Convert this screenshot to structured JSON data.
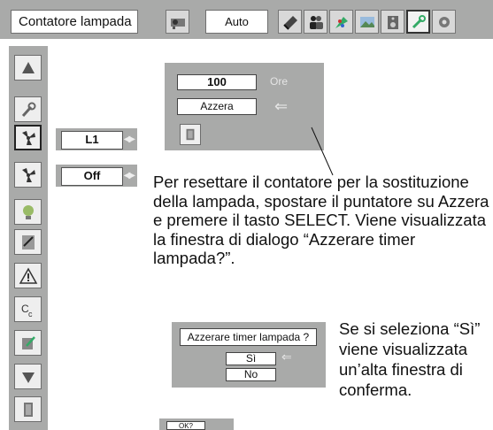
{
  "toolbar": {
    "title": "Contatore lampada",
    "mode_value": "Auto",
    "icons": [
      "projector-icon",
      "laptop-icon",
      "people-icon",
      "palette-icon",
      "image-icon",
      "speaker-icon",
      "wrench-icon",
      "gear-icon"
    ]
  },
  "sidebar": {
    "icons": [
      "arrow-up-icon",
      "wrench-icon",
      "fan-icon",
      "fan-icon",
      "lamp-icon",
      "notepad-icon",
      "warning-icon",
      "cc-icon",
      "settings-icon",
      "arrow-down-icon",
      "exit-icon"
    ]
  },
  "submenu": {
    "row1_value": "L1",
    "row2_value": "Off",
    "arrows": "◀▶"
  },
  "lamp_dialog": {
    "hours_value": "100",
    "hours_unit": "Ore",
    "reset_label": "Azzera",
    "arrow": "⇐"
  },
  "instructions": {
    "main": "Per resettare il contatore per la sostituzione della lampada, spostare il puntatore su Azzera e premere il tasto SELECT. Viene visualizzata la finestra di dialogo “Azzerare timer lampada?”.",
    "side": "Se si seleziona “Sì” viene visualizzata un’alta finestra di conferma."
  },
  "confirm_dialog": {
    "question": "Azzerare timer lampada ?",
    "yes": "Sì",
    "no": "No",
    "arrow": "⇐"
  },
  "ok_dialog": {
    "label": "OK?"
  }
}
